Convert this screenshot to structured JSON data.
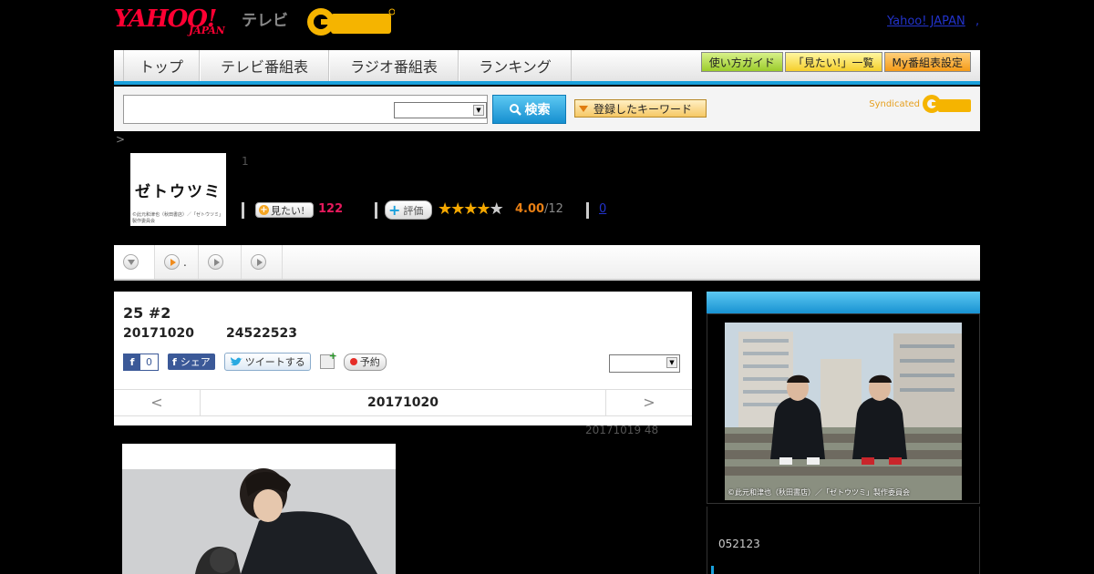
{
  "header": {
    "logo_yahoo": "YAHOO!",
    "logo_japan": "JAPAN",
    "logo_tv": "テレビ",
    "logo_gguide": "G GUIDE",
    "yahoo_japan_link": "Yahoo! JAPAN",
    "link_dot": ","
  },
  "nav": {
    "tabs": [
      {
        "label": "トップ"
      },
      {
        "label": "テレビ番組表"
      },
      {
        "label": "ラジオ番組表"
      },
      {
        "label": "ランキング"
      }
    ],
    "guide_button": "使い方ガイド",
    "mitai_list_button": "「見たい!」一覧",
    "my_schedule_button": "My番組表設定"
  },
  "search": {
    "input_value": "",
    "select_value": "",
    "button_label": "検索",
    "keyword_button": "登録したキーワード",
    "syndicated_label": "Syndicated"
  },
  "breadcrumb": ">",
  "program": {
    "thumb_title": "ゼトウツミ",
    "thumb_copyright": "©此元和津也（秋田書店）／「ゼトウツミ」製作委員会",
    "episode_count": "1",
    "mitai_label": "見たい!",
    "mitai_count": "122",
    "hyouka_label": "評価",
    "rating_value": "4.00",
    "rating_count": "/12",
    "comment_count": "0",
    "stars": {
      "full": 4,
      "total": 5
    }
  },
  "subtabs": [
    {
      "label": ""
    },
    {
      "label": "."
    },
    {
      "label": ""
    },
    {
      "label": ""
    }
  ],
  "episode": {
    "title": "25  #2",
    "date": "20171020",
    "time": "24522523",
    "fb_like_count": "0",
    "fb_share_label": "シェア",
    "tweet_label": "ツイートする",
    "reserve_label": "予約",
    "select_value": "",
    "pager_prev": "<",
    "pager_date": "20171020",
    "pager_next": ">",
    "updated": "20171019  48"
  },
  "side": {
    "photo_caption": "©此元和津也（秋田書店）／「ゼトウツミ」製作委員会",
    "text": "052123"
  },
  "colors": {
    "accent_blue": "#19a0dc",
    "yahoo_red": "#ff0033",
    "mitai_pink": "#e6195c",
    "rating_orange": "#e87f14",
    "link_blue": "#2233cc"
  }
}
